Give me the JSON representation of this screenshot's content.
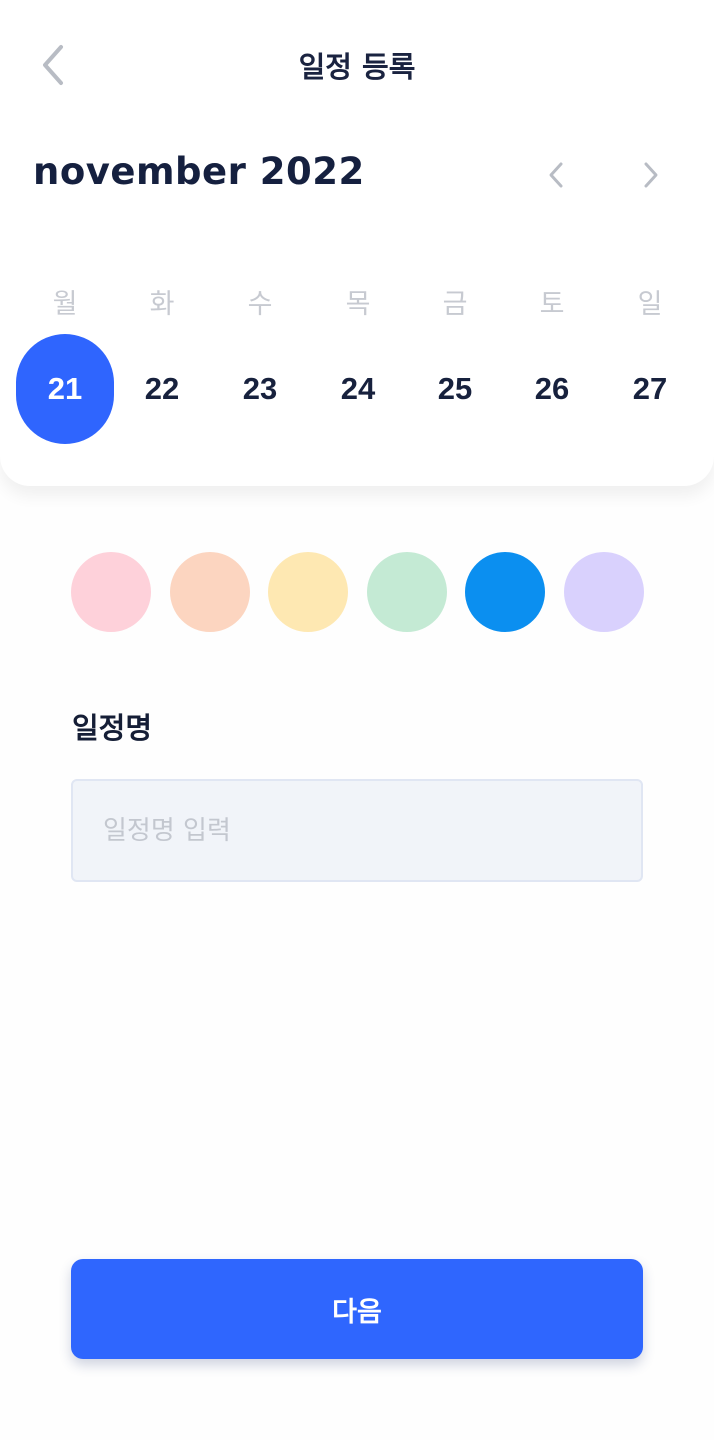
{
  "header": {
    "title": "일정 등록"
  },
  "calendar": {
    "month_label": "november 2022",
    "weekdays": [
      "월",
      "화",
      "수",
      "목",
      "금",
      "토",
      "일"
    ],
    "dates": [
      "21",
      "22",
      "23",
      "24",
      "25",
      "26",
      "27"
    ],
    "selected_date": "21"
  },
  "colors": {
    "palette": [
      "#fed1da",
      "#fcd5c0",
      "#fee8b2",
      "#c4ead4",
      "#0b8ff0",
      "#d9d1fd"
    ],
    "selected": "#0b8ff0",
    "accent": "#2f66fe"
  },
  "form": {
    "name_label": "일정명",
    "name_placeholder": "일정명 입력",
    "name_value": ""
  },
  "footer": {
    "next_label": "다음"
  },
  "icons": {
    "back": "chevron-left-icon",
    "prev_month": "chevron-left-icon",
    "next_month": "chevron-right-icon"
  }
}
